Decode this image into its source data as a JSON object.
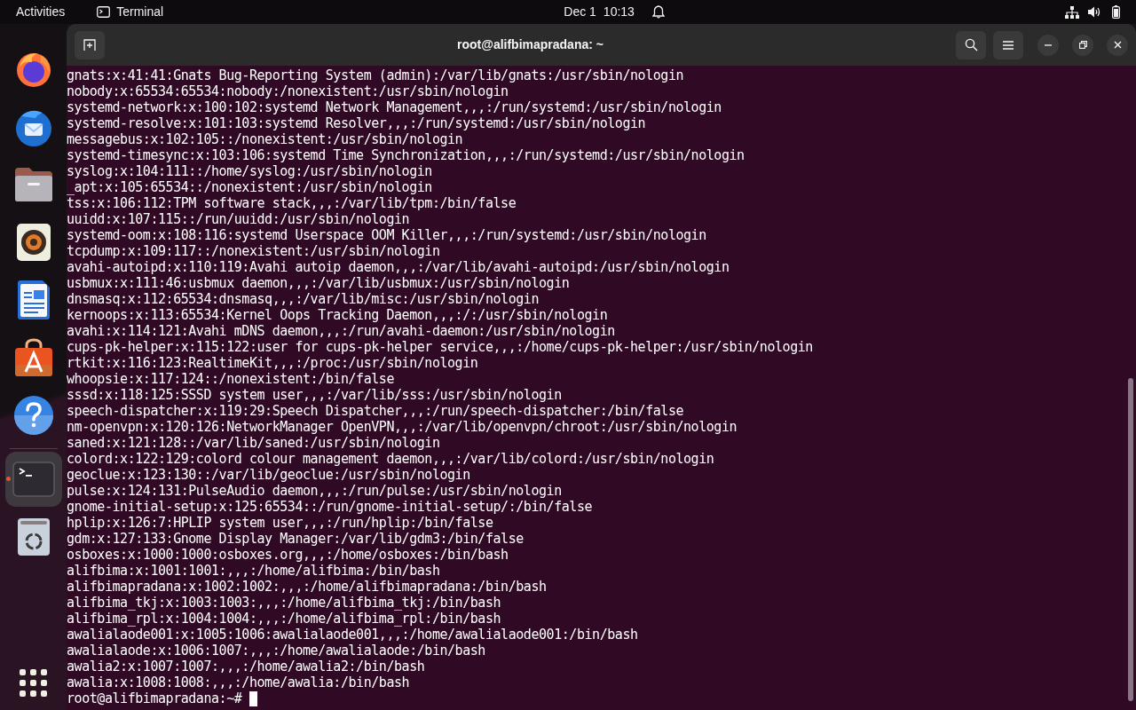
{
  "top_bar": {
    "activities": "Activities",
    "app_name": "Terminal",
    "date": "Dec 1",
    "time": "10:13"
  },
  "dock": [
    {
      "kind": "firefox",
      "active": false
    },
    {
      "kind": "thunderbird",
      "active": false
    },
    {
      "kind": "files",
      "active": false
    },
    {
      "kind": "rhythmbox",
      "active": false
    },
    {
      "kind": "writer",
      "active": false
    },
    {
      "kind": "appstore",
      "active": false
    },
    {
      "kind": "help",
      "active": false
    },
    {
      "kind": "terminal",
      "active": true
    },
    {
      "kind": "trash",
      "active": false
    }
  ],
  "window": {
    "title": "root@alifbimapradana: ~"
  },
  "terminal": {
    "lines": [
      "gnats:x:41:41:Gnats Bug-Reporting System (admin):/var/lib/gnats:/usr/sbin/nologin",
      "nobody:x:65534:65534:nobody:/nonexistent:/usr/sbin/nologin",
      "systemd-network:x:100:102:systemd Network Management,,,:/run/systemd:/usr/sbin/nologin",
      "systemd-resolve:x:101:103:systemd Resolver,,,:/run/systemd:/usr/sbin/nologin",
      "messagebus:x:102:105::/nonexistent:/usr/sbin/nologin",
      "systemd-timesync:x:103:106:systemd Time Synchronization,,,:/run/systemd:/usr/sbin/nologin",
      "syslog:x:104:111::/home/syslog:/usr/sbin/nologin",
      "_apt:x:105:65534::/nonexistent:/usr/sbin/nologin",
      "tss:x:106:112:TPM software stack,,,:/var/lib/tpm:/bin/false",
      "uuidd:x:107:115::/run/uuidd:/usr/sbin/nologin",
      "systemd-oom:x:108:116:systemd Userspace OOM Killer,,,:/run/systemd:/usr/sbin/nologin",
      "tcpdump:x:109:117::/nonexistent:/usr/sbin/nologin",
      "avahi-autoipd:x:110:119:Avahi autoip daemon,,,:/var/lib/avahi-autoipd:/usr/sbin/nologin",
      "usbmux:x:111:46:usbmux daemon,,,:/var/lib/usbmux:/usr/sbin/nologin",
      "dnsmasq:x:112:65534:dnsmasq,,,:/var/lib/misc:/usr/sbin/nologin",
      "kernoops:x:113:65534:Kernel Oops Tracking Daemon,,,:/:/usr/sbin/nologin",
      "avahi:x:114:121:Avahi mDNS daemon,,,:/run/avahi-daemon:/usr/sbin/nologin",
      "cups-pk-helper:x:115:122:user for cups-pk-helper service,,,:/home/cups-pk-helper:/usr/sbin/nologin",
      "rtkit:x:116:123:RealtimeKit,,,:/proc:/usr/sbin/nologin",
      "whoopsie:x:117:124::/nonexistent:/bin/false",
      "sssd:x:118:125:SSSD system user,,,:/var/lib/sss:/usr/sbin/nologin",
      "speech-dispatcher:x:119:29:Speech Dispatcher,,,:/run/speech-dispatcher:/bin/false",
      "nm-openvpn:x:120:126:NetworkManager OpenVPN,,,:/var/lib/openvpn/chroot:/usr/sbin/nologin",
      "saned:x:121:128::/var/lib/saned:/usr/sbin/nologin",
      "colord:x:122:129:colord colour management daemon,,,:/var/lib/colord:/usr/sbin/nologin",
      "geoclue:x:123:130::/var/lib/geoclue:/usr/sbin/nologin",
      "pulse:x:124:131:PulseAudio daemon,,,:/run/pulse:/usr/sbin/nologin",
      "gnome-initial-setup:x:125:65534::/run/gnome-initial-setup/:/bin/false",
      "hplip:x:126:7:HPLIP system user,,,:/run/hplip:/bin/false",
      "gdm:x:127:133:Gnome Display Manager:/var/lib/gdm3:/bin/false",
      "osboxes:x:1000:1000:osboxes.org,,,:/home/osboxes:/bin/bash",
      "alifbima:x:1001:1001:,,,:/home/alifbima:/bin/bash",
      "alifbimapradana:x:1002:1002:,,,:/home/alifbimapradana:/bin/bash",
      "alifbima_tkj:x:1003:1003:,,,:/home/alifbima_tkj:/bin/bash",
      "alifbima_rpl:x:1004:1004:,,,:/home/alifbima_rpl:/bin/bash",
      "awalialaode001:x:1005:1006:awalialaode001,,,:/home/awalialaode001:/bin/bash",
      "awalialaode:x:1006:1007:,,,:/home/awalialaode:/bin/bash",
      "awalia2:x:1007:1007:,,,:/home/awalia2:/bin/bash",
      "awalia:x:1008:1008:,,,:/home/awalia:/bin/bash"
    ],
    "prompt": "root@alifbimapradana:~#"
  }
}
